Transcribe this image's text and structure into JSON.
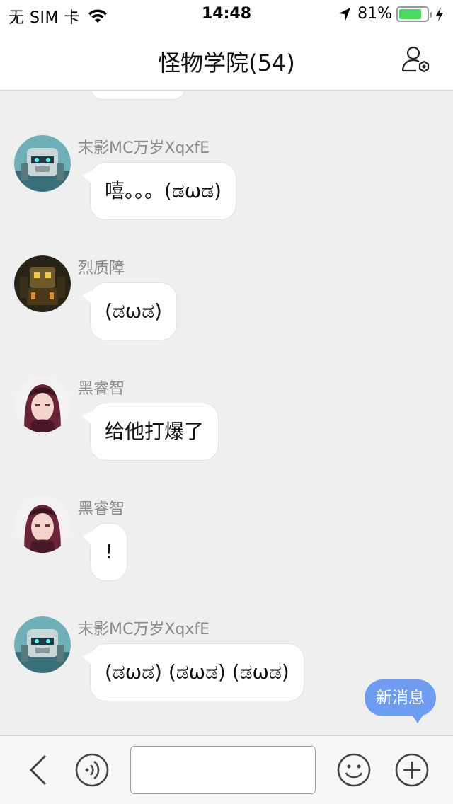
{
  "status_bar": {
    "carrier": "无 SIM 卡",
    "time": "14:48",
    "battery_percent_text": "81%",
    "battery_level": 0.81
  },
  "header": {
    "title": "怪物学院(54)",
    "settings_icon": "group-settings-icon"
  },
  "messages": [
    {
      "sender": "末影MC万岁XqxfE",
      "text": "嘻。。。(ಡωಡ)",
      "avatar": "robot-avatar"
    },
    {
      "sender": "烈质障",
      "text": "(ಡωಡ)",
      "avatar": "mecha-avatar"
    },
    {
      "sender": "黑睿智",
      "text": "给他打爆了",
      "avatar": "anime-girl-avatar"
    },
    {
      "sender": "黑睿智",
      "text": "!",
      "avatar": "anime-girl-avatar"
    },
    {
      "sender": "末影MC万岁XqxfE",
      "text": "(ಡωಡ) (ಡωಡ) (ಡωಡ)",
      "avatar": "robot-avatar"
    }
  ],
  "new_message_badge": "新消息",
  "toolbar": {
    "input_value": "",
    "input_placeholder": "",
    "icons": [
      "back-icon",
      "voice-icon",
      "emoji-icon",
      "plus-icon"
    ]
  },
  "colors": {
    "accent_blue": "#6d9cf0",
    "battery_green": "#4cd964",
    "chat_background": "#efefef"
  }
}
